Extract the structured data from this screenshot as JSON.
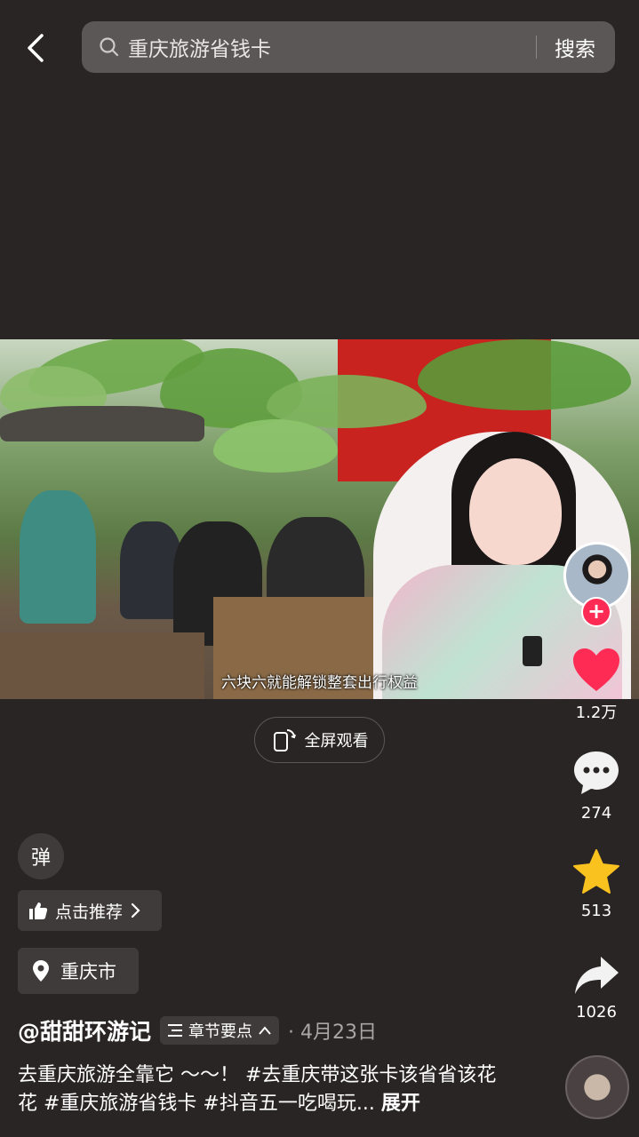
{
  "search": {
    "query": "重庆旅游省钱卡",
    "submit_label": "搜索"
  },
  "video": {
    "caption": "六块六就能解锁整套出行权益",
    "fullscreen_label": "全屏观看"
  },
  "actions": {
    "like_count": "1.2万",
    "comment_count": "274",
    "favorite_count": "513",
    "share_count": "1026"
  },
  "danmu_label": "弹",
  "recommend_label": "点击推荐",
  "location_label": "重庆市",
  "author": {
    "name": "@甜甜环游记",
    "chapter_label": "章节要点",
    "date": "· 4月23日"
  },
  "description": {
    "text": "去重庆旅游全靠它 ～～！ #去重庆带这张卡该省省该花花 #重庆旅游省钱卡 #抖音五一吃喝玩...",
    "more_label": "展开"
  },
  "colors": {
    "like_red": "#fe2c55",
    "favorite_yellow": "#f9c21e",
    "background": "#2a2525"
  }
}
